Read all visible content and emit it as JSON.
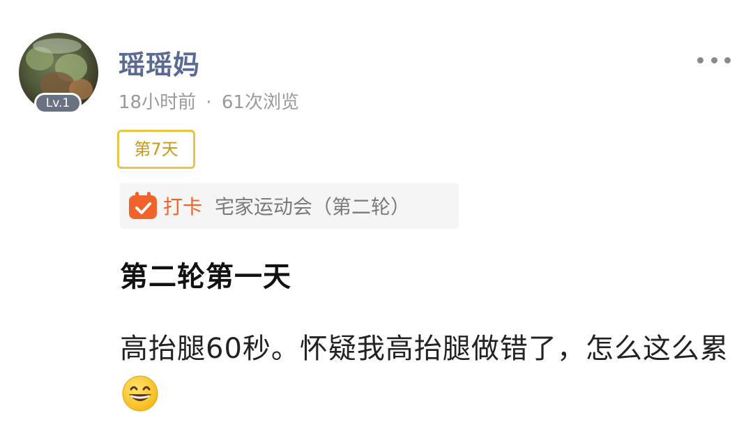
{
  "user": {
    "name": "瑶瑶妈",
    "level": "Lv.1"
  },
  "meta": {
    "time": "18小时前",
    "separator": "·",
    "views": "61次浏览"
  },
  "tag": {
    "day": "第7天"
  },
  "checkin": {
    "label": "打卡",
    "topic": "宅家运动会（第二轮）",
    "icon": "calendar-check-icon",
    "color": "#f0642b"
  },
  "post": {
    "title": "第二轮第一天",
    "body": "高抬腿60秒。怀疑我高抬腿做错了，怎么这么累",
    "emoji": "grinning-face-icon"
  },
  "actions": {
    "more_icon": "more-dots-icon"
  },
  "colors": {
    "username": "#5a6a92",
    "tag_border": "#e9c446",
    "tag_text": "#c89a1a"
  }
}
